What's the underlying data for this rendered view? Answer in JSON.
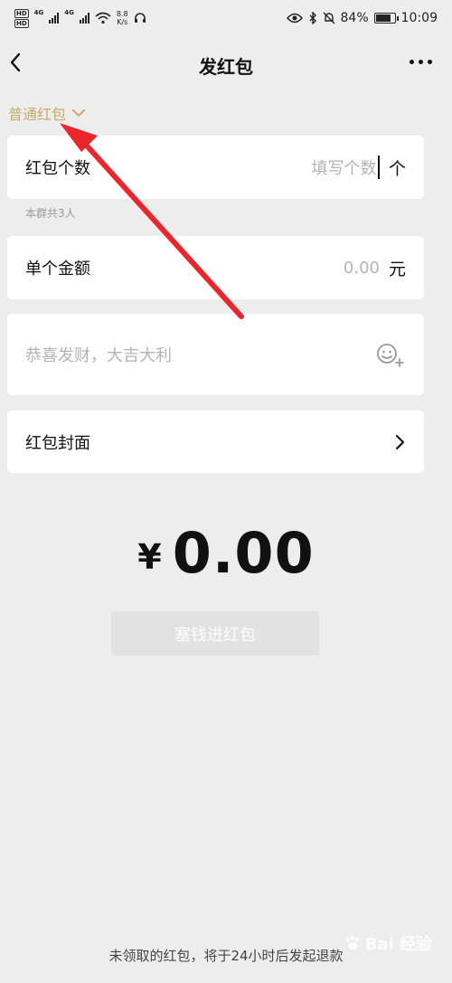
{
  "status_bar": {
    "speed_value": "8.8",
    "speed_unit": "K/s",
    "battery": "84%",
    "time": "10:09",
    "net_tag_1": "4G",
    "net_tag_2": "4G",
    "hd_label": "HD"
  },
  "nav": {
    "title": "发红包"
  },
  "packet_type": {
    "label": "普通红包"
  },
  "quantity": {
    "label": "红包个数",
    "placeholder": "填写个数",
    "unit": "个",
    "note": "本群共3人"
  },
  "amount_row": {
    "label": "单个金额",
    "placeholder": "0.00",
    "unit": "元"
  },
  "greeting": {
    "placeholder": "恭喜发财，大吉大利"
  },
  "cover": {
    "label": "红包封面"
  },
  "total": {
    "currency": "¥",
    "value": "0.00"
  },
  "send_button": {
    "label": "塞钱进红包"
  },
  "footer": {
    "note": "未领取的红包，将于24小时后发起退款"
  },
  "watermark": {
    "text": "Bai 经验"
  },
  "colors": {
    "accent_gold": "#c9a86a",
    "background": "#ededed",
    "annotation_arrow": "#e8262b"
  }
}
